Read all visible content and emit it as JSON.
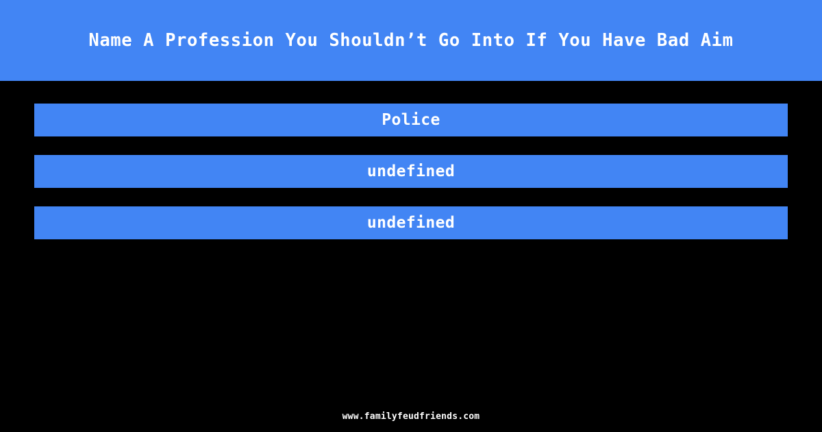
{
  "theme": {
    "background_color": "#000000",
    "accent_color": "#4285f4",
    "text_color": "#ffffff"
  },
  "header": {
    "question": "Name A Profession You Shouldn’t Go Into If You Have Bad Aim"
  },
  "answers": [
    {
      "text": "Police"
    },
    {
      "text": "undefined"
    },
    {
      "text": "undefined"
    }
  ],
  "footer": {
    "url": "www.familyfeudfriends.com"
  }
}
